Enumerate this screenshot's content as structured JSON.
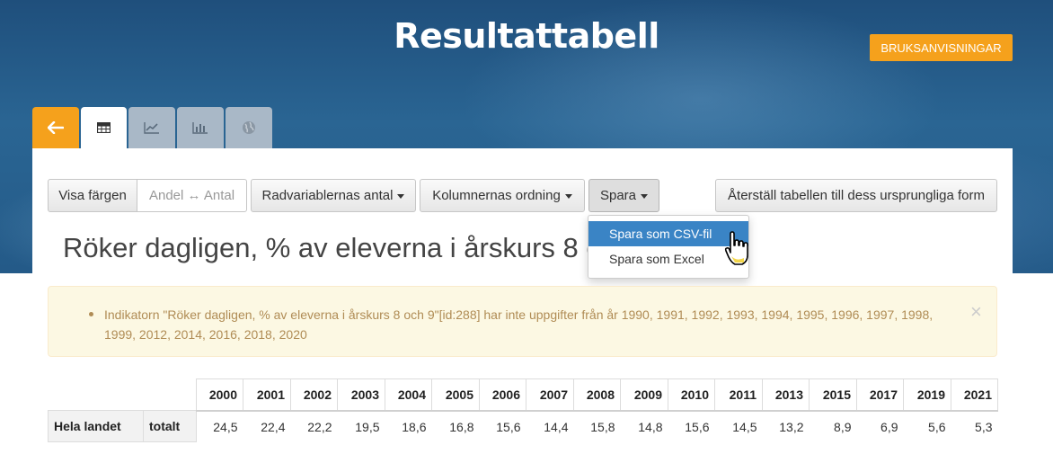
{
  "header": {
    "title": "Resultattabell",
    "manual_label": "BRUKSANVISNINGAR",
    "accent": "#f5a11c"
  },
  "tabs": [
    {
      "icon": "back-arrow-icon",
      "active": false
    },
    {
      "icon": "table-icon",
      "active": true
    },
    {
      "icon": "line-chart-icon",
      "active": false
    },
    {
      "icon": "bar-chart-icon",
      "active": false
    },
    {
      "icon": "globe-icon",
      "active": false
    }
  ],
  "toolbar": {
    "show_colors": "Visa färgen",
    "share_count": "Andel ↔ Antal",
    "row_vars": "Radvariablernas antal",
    "col_order": "Kolumnernas ordning",
    "save": "Spara",
    "reset": "Återställ tabellen till dess ursprungliga form"
  },
  "save_menu": {
    "items": [
      "Spara som CSV-fil",
      "Spara som Excel"
    ],
    "highlighted": "Spara som CSV-fil"
  },
  "heading": "Röker dagligen, % av eleverna i årskurs 8 o",
  "alert": {
    "text": "Indikatorn \"Röker dagligen, % av eleverna i årskurs 8 och 9\"[id:288] har inte uppgifter från år 1990, 1991, 1992, 1993, 1994, 1995, 1996, 1997, 1998, 1999, 2012, 2014, 2016, 2018, 2020",
    "close": "×"
  },
  "table": {
    "years": [
      "2000",
      "2001",
      "2002",
      "2003",
      "2004",
      "2005",
      "2006",
      "2007",
      "2008",
      "2009",
      "2010",
      "2011",
      "2013",
      "2015",
      "2017",
      "2019",
      "2021"
    ],
    "row_label": "Hela landet",
    "row_sublabel": "totalt",
    "values": [
      "24,5",
      "22,4",
      "22,2",
      "19,5",
      "18,6",
      "16,8",
      "15,6",
      "14,4",
      "15,8",
      "14,8",
      "15,6",
      "14,5",
      "13,2",
      "8,9",
      "6,9",
      "5,6",
      "5,3"
    ]
  }
}
